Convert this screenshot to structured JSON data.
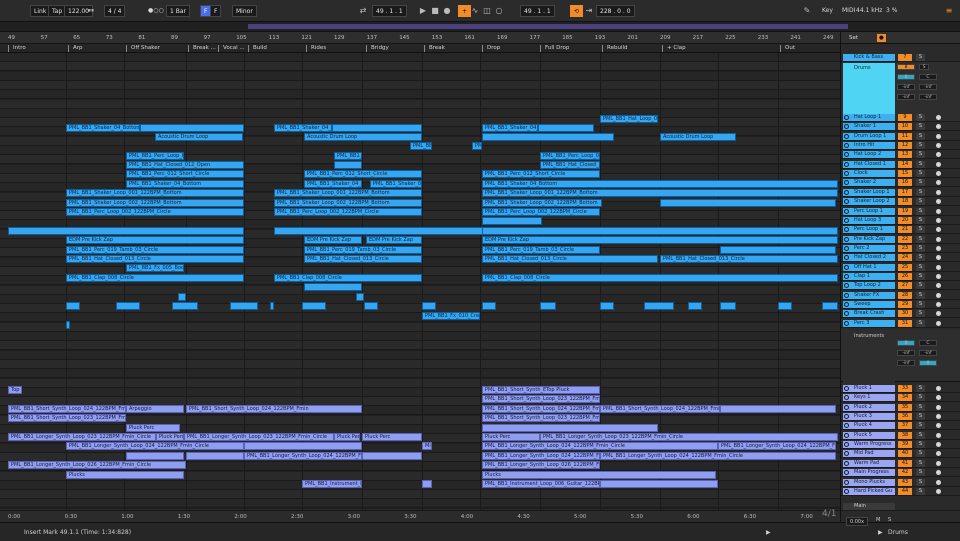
{
  "transport": {
    "link": "Link",
    "tap": "Tap",
    "tempo": "122.00",
    "signature": "4 / 4",
    "metronome": "●○○",
    "quantize": "1 Bar",
    "key_toggle": "F",
    "key": "F",
    "scale": "Minor",
    "position": "49 .  1 .  1",
    "loop_start": "49 .  1 .  1",
    "loop_length": "228 .  0 .  0",
    "key_label": "Key",
    "midi_label": "MIDI",
    "sample_rate": "44.1 kHz",
    "cpu": "3 %"
  },
  "ruler": [
    "49",
    "57",
    "65",
    "73",
    "81",
    "89",
    "97",
    "105",
    "113",
    "121",
    "129",
    "137",
    "145",
    "153",
    "161",
    "169",
    "177",
    "185",
    "193",
    "201",
    "209",
    "217",
    "225",
    "233",
    "241",
    "249"
  ],
  "markers": [
    "Intro",
    "Arp",
    "Off Shaker",
    "Break ...",
    "Vocal ...",
    "Build",
    "Rides",
    "Bridgy",
    "Break",
    "Drop",
    "Full Drop",
    "Rebuild",
    "+ Clap",
    "Out"
  ],
  "time_ruler": [
    "0:00",
    "0:30",
    "1:00",
    "1:30",
    "2:00",
    "2:30",
    "3:00",
    "3:30",
    "4:00",
    "4:30",
    "5:00",
    "5:30",
    "6:00",
    "6:30",
    "7:00"
  ],
  "clips": {
    "c1": "PML_BB1_Hat_Loop_01",
    "c2": "PML_BB1_Shaker_04_Bottom",
    "c3": "Acoustic Drum Loop",
    "c4": "PML_BB1_Shaker_04_Bottom",
    "c5": "Acoustic Drum Loop",
    "c6": "PML_BB1_Shaker_04_Bottom",
    "c7": "Acoustic Drum Loop",
    "c8": "PML_BB",
    "c9": "PML_BB1_Perc_Loop_003",
    "c10": "PML_BB1_Hat_Closed_012_Open",
    "c11": "PML_BB1_Perc_012_Short_Circle",
    "c12": "PML_BB1_Shaker_04_Bottom",
    "c13": "PML_BB1_Shaker_Loop_001_122BPM_Bottom",
    "c14": "PML_BB1_Shaker_Loop_002_122BPM_Bottom",
    "c15": "PML_BB1_Perc_Loop_002_122BPM_Circle",
    "c16": "EDM Pre Kick Zap",
    "c17": "PML_BB1_Perc_019_Tamb_03_Circle",
    "c18": "PML_BB1_Hat_Closed_013_Circle",
    "c19": "PML_BB1_Fx_005_Boom",
    "c20": "PML_BB1_Clap_008_Circle",
    "c21": "PML_BB1_Fx_010_Cres",
    "c22": "Top P",
    "c23": "PML_BB1_Short_Synth_Loop_024_122BPM_Fmin",
    "c24": "Arpeggio",
    "c25": "PML_BB1_Short_Synth_Loop_023_122BPM_Fmin_Circle",
    "c26": "Pluck Perc",
    "c27": "PML_BB1_Longer_Synth_Loop_023_122BPM_Fmin_Circle",
    "c28": "PML_BB1_Longer_Synth_Loop_024_122BPM_Fmin_Circle",
    "c29": "PML_BB1_Longer_Synth_Loop_026_122BPM_Fmin_Circle",
    "c30": "Plucks",
    "c31": "PML_BB1_Instrument_Loop_006_Guitar_122BPM_Fmin",
    "c32": "PML_BB1_Short_Synth_ETop Pluck",
    "c33": "Mid"
  },
  "right_tabs": [
    "Set",
    "●"
  ],
  "groups": {
    "kick_bass": "Kick & Bass",
    "drums": "Drums",
    "instruments": "Instruments"
  },
  "tracks": [
    {
      "name": "Hat Loop 1",
      "num": "9"
    },
    {
      "name": "Shaker 1",
      "num": "10"
    },
    {
      "name": "Drum Loop 1",
      "num": "11"
    },
    {
      "name": "Intro Hit",
      "num": "12"
    },
    {
      "name": "Hat Loop 2",
      "num": "13"
    },
    {
      "name": "Hat Closed 1",
      "num": "14"
    },
    {
      "name": "Clock",
      "num": "15"
    },
    {
      "name": "Shaker 2",
      "num": "16"
    },
    {
      "name": "Shaker Loop 1",
      "num": "17"
    },
    {
      "name": "Shaker Loop 2",
      "num": "18"
    },
    {
      "name": "Perc Loop 1",
      "num": "19"
    },
    {
      "name": "Hat Loop 3",
      "num": "20"
    },
    {
      "name": "Perc Loop 1",
      "num": "21"
    },
    {
      "name": "Pre Kick Zap",
      "num": "22"
    },
    {
      "name": "Perc 2",
      "num": "23"
    },
    {
      "name": "Hat Closed 2",
      "num": "24"
    },
    {
      "name": "Off Hat 1",
      "num": "25"
    },
    {
      "name": "Clap 1",
      "num": "26"
    },
    {
      "name": "Top Loop 2",
      "num": "27"
    },
    {
      "name": "Shaker FX",
      "num": "28"
    },
    {
      "name": "Sweep",
      "num": "29"
    },
    {
      "name": "Break Crash",
      "num": "30"
    },
    {
      "name": "Perc 3",
      "num": "31"
    }
  ],
  "inst_tracks": [
    {
      "name": "Pluck 1",
      "num": "33"
    },
    {
      "name": "Keys 1",
      "num": "34"
    },
    {
      "name": "Pluck 2",
      "num": "35"
    },
    {
      "name": "Pluck 3",
      "num": "36"
    },
    {
      "name": "Pluck 4",
      "num": "37"
    },
    {
      "name": "Pluck 5",
      "num": "38"
    },
    {
      "name": "Warm Progress",
      "num": "39"
    },
    {
      "name": "Mid Pad",
      "num": "40"
    },
    {
      "name": "Warm Pad",
      "num": "41"
    },
    {
      "name": "Main Progress",
      "num": "42"
    },
    {
      "name": "Mono Plucks",
      "num": "43"
    },
    {
      "name": "Hard Picked Gu",
      "num": "44"
    }
  ],
  "main_label": "Main",
  "status_text": "Insert Mark 49.1.1 (Time: 1:34:828)",
  "zoom": "4/1",
  "tempo_small": "0.00x",
  "drums_footer": "Drums",
  "bottom_buttons": {
    "m": "M",
    "s": "S"
  }
}
